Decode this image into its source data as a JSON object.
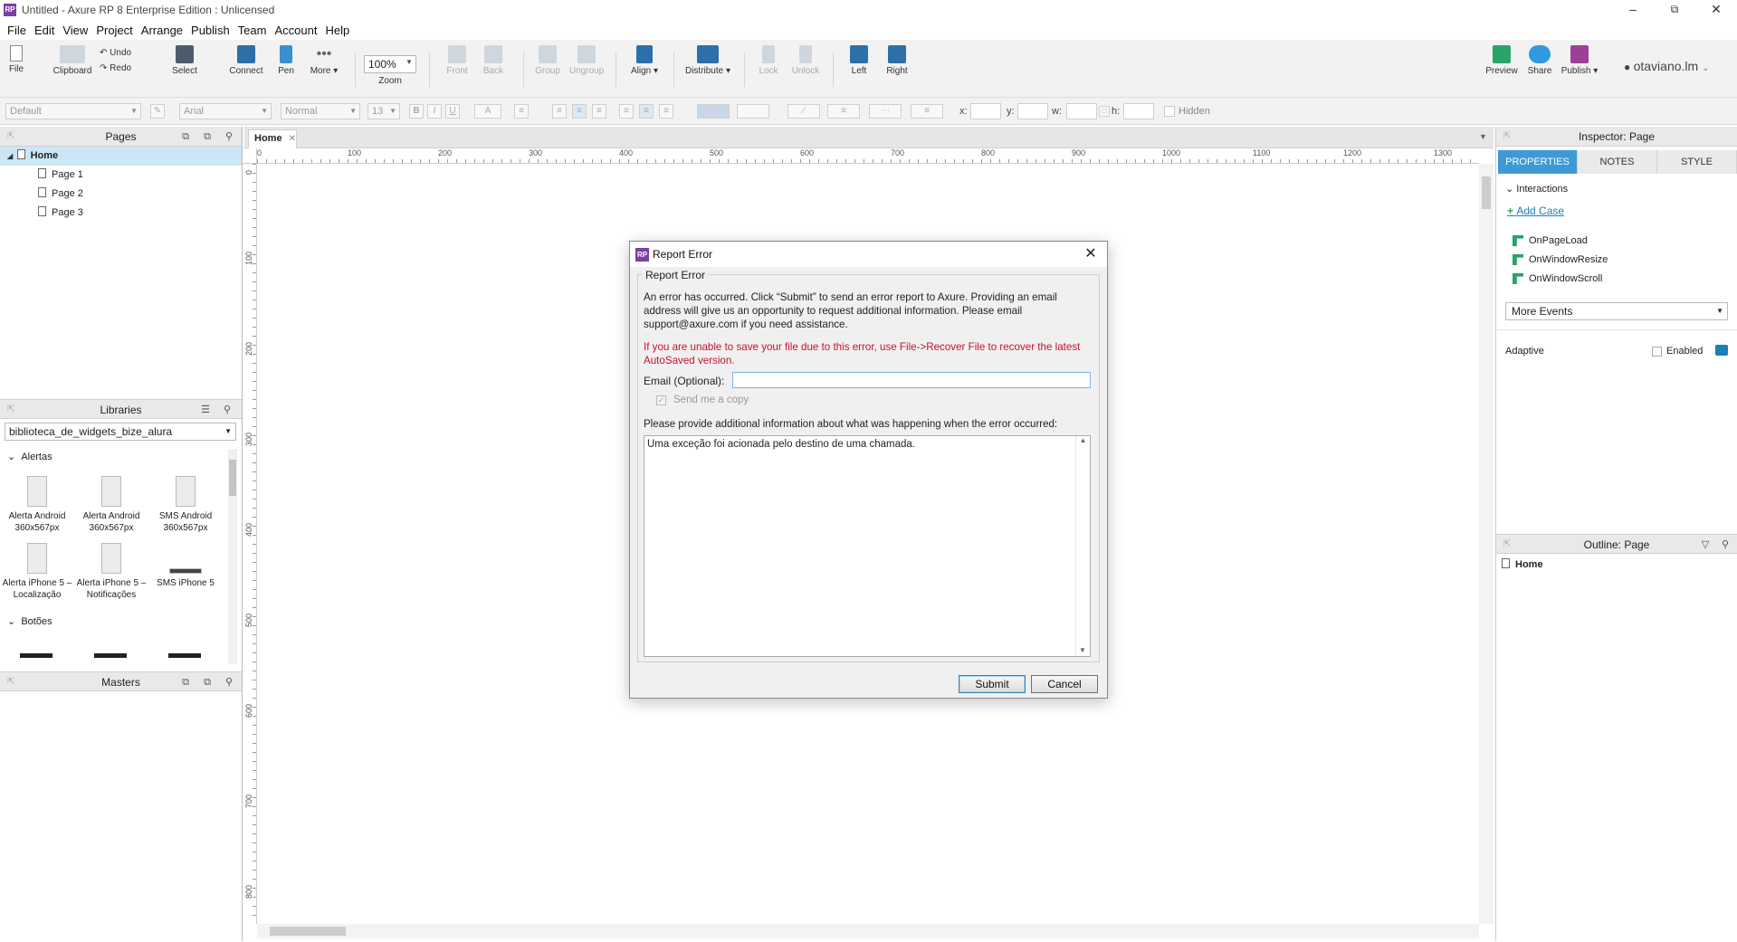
{
  "window": {
    "title": "Untitled - Axure RP 8 Enterprise Edition : Unlicensed",
    "logo": "RP",
    "controls": [
      "–",
      "⧉",
      "✕"
    ]
  },
  "menu": [
    "File",
    "Edit",
    "View",
    "Project",
    "Arrange",
    "Publish",
    "Team",
    "Account",
    "Help"
  ],
  "toolbar": {
    "file": "File",
    "clipboard": "Clipboard",
    "undo": "Undo",
    "redo": "Redo",
    "select": "Select",
    "connect": "Connect",
    "pen": "Pen",
    "more": "More ▾",
    "zoom_value": "100%",
    "zoom": "Zoom",
    "front": "Front",
    "back": "Back",
    "group": "Group",
    "ungroup": "Ungroup",
    "align": "Align ▾",
    "distribute": "Distribute ▾",
    "lock": "Lock",
    "unlock": "Unlock",
    "left": "Left",
    "right": "Right",
    "preview": "Preview",
    "share": "Share",
    "publish": "Publish ▾",
    "user": "otaviano.lm"
  },
  "formatbar": {
    "style": "Default",
    "font": "Arial",
    "weight": "Normal",
    "size": "13",
    "x_label": "x:",
    "y_label": "y:",
    "w_label": "w:",
    "h_label": "h:",
    "hidden": "Hidden"
  },
  "pages": {
    "title": "Pages",
    "items": [
      {
        "label": "Home",
        "selected": true
      },
      {
        "label": "Page 1"
      },
      {
        "label": "Page 2"
      },
      {
        "label": "Page 3"
      }
    ]
  },
  "libraries": {
    "title": "Libraries",
    "selected": "biblioteca_de_widgets_bize_alura",
    "sections": [
      "Alertas",
      "Botões"
    ],
    "items": [
      {
        "label": "Alerta Android 360x567px"
      },
      {
        "label": "Alerta Android 360x567px"
      },
      {
        "label": "SMS Android 360x567px"
      },
      {
        "label": "Alerta iPhone 5 – Localização"
      },
      {
        "label": "Alerta iPhone 5 – Notificações"
      },
      {
        "label": "SMS iPhone 5"
      }
    ]
  },
  "masters": {
    "title": "Masters"
  },
  "canvas": {
    "tab": "Home",
    "ruler_h": [
      "0",
      "100",
      "200",
      "300",
      "400",
      "500",
      "600",
      "700",
      "800",
      "900",
      "1000",
      "1100",
      "1200",
      "1300"
    ],
    "ruler_v": [
      "0",
      "100",
      "200",
      "300",
      "400",
      "500",
      "600",
      "700",
      "800"
    ]
  },
  "inspector": {
    "title": "Inspector: Page",
    "tabs": [
      "PROPERTIES",
      "NOTES",
      "STYLE"
    ],
    "active_tab": "PROPERTIES",
    "interactions": "Interactions",
    "add_case": "Add Case",
    "events": [
      "OnPageLoad",
      "OnWindowResize",
      "OnWindowScroll"
    ],
    "more_events": "More Events",
    "adaptive": "Adaptive",
    "enabled": "Enabled",
    "outline_title": "Outline: Page",
    "outline_item": "Home"
  },
  "dialog": {
    "title": "Report Error",
    "group": "Report Error",
    "message": "An error has occurred. Click “Submit” to send an error report to Axure. Providing an email address will give us an opportunity to request additional information. Please email support@axure.com if you need assistance.",
    "warning": "If you are unable to save your file due to this error, use File->Recover File to recover the latest AutoSaved version.",
    "email_label": "Email (Optional):",
    "email_value": "",
    "copy_label": "Send me a copy",
    "info_label": "Please provide additional information about what was happening when the error occurred:",
    "info_text": "Uma exceção foi acionada pelo destino de uma chamada.",
    "submit": "Submit",
    "cancel": "Cancel"
  }
}
